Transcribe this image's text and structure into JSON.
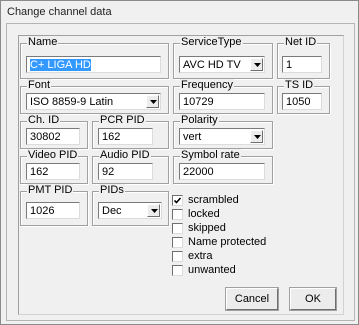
{
  "window": {
    "title": "Change channel data"
  },
  "fields": {
    "name": {
      "label": "Name",
      "value": "C+ LIGA HD"
    },
    "service_type": {
      "label": "ServiceType",
      "value": "AVC HD TV"
    },
    "net_id": {
      "label": "Net ID",
      "value": "1"
    },
    "font": {
      "label": "Font",
      "value": "ISO 8859-9 Latin"
    },
    "frequency": {
      "label": "Frequency",
      "value": "10729"
    },
    "ts_id": {
      "label": "TS ID",
      "value": "1050"
    },
    "ch_id": {
      "label": "Ch. ID",
      "value": "30802"
    },
    "pcr_pid": {
      "label": "PCR PID",
      "value": "162"
    },
    "polarity": {
      "label": "Polarity",
      "value": "vert"
    },
    "video_pid": {
      "label": "Video PID",
      "value": "162"
    },
    "audio_pid": {
      "label": "Audio PID",
      "value": "92"
    },
    "symbol_rate": {
      "label": "Symbol rate",
      "value": "22000"
    },
    "pmt_pid": {
      "label": "PMT PID",
      "value": "1026"
    },
    "pids": {
      "label": "PIDs",
      "value": "Dec"
    }
  },
  "checkboxes": [
    {
      "label": "scrambled",
      "checked": true
    },
    {
      "label": "locked",
      "checked": false
    },
    {
      "label": "skipped",
      "checked": false
    },
    {
      "label": "Name protected",
      "checked": false
    },
    {
      "label": "extra",
      "checked": false
    },
    {
      "label": "unwanted",
      "checked": false
    }
  ],
  "buttons": {
    "cancel": "Cancel",
    "ok": "OK"
  }
}
